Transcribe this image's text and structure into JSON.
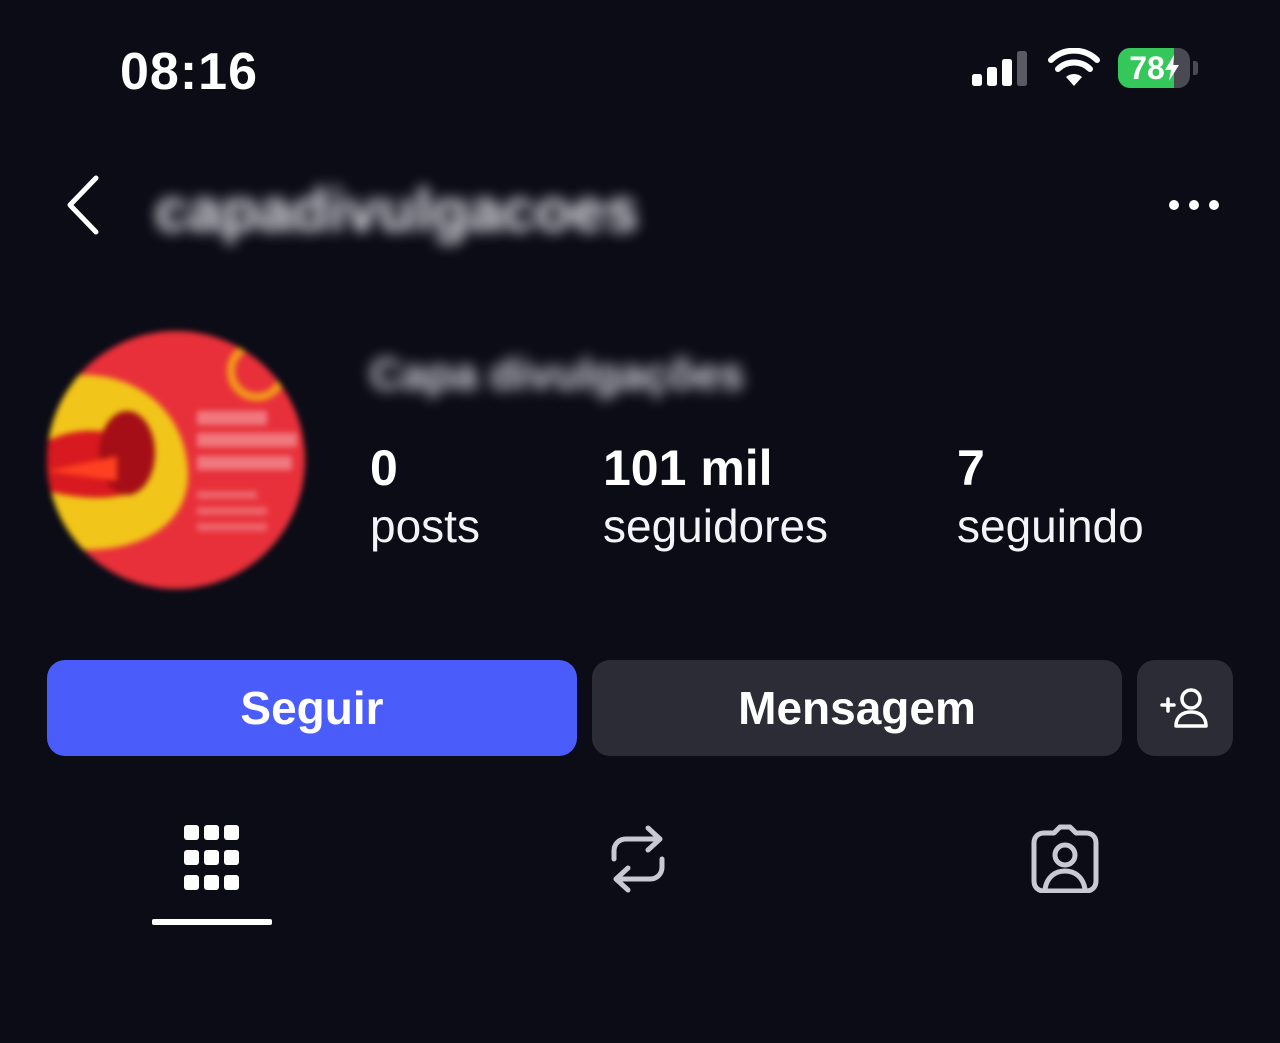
{
  "status_bar": {
    "time": "08:16",
    "battery_level": "78",
    "battery_fill_percent": 78,
    "signal_icon": "cellular-signal-icon",
    "wifi_icon": "wifi-icon",
    "charging_icon": "bolt-icon"
  },
  "header": {
    "back_icon": "chevron-left-icon",
    "username": "capadivulgacoes",
    "more_icon": "more-horizontal-icon"
  },
  "profile": {
    "display_name": "Capa divulgações",
    "stats": [
      {
        "value": "0",
        "label": "posts"
      },
      {
        "value": "101 mil",
        "label": "seguidores"
      },
      {
        "value": "7",
        "label": "seguindo"
      }
    ]
  },
  "actions": {
    "follow_label": "Seguir",
    "message_label": "Mensagem",
    "add_person_icon": "add-person-icon"
  },
  "tabs": {
    "posts_icon": "grid-icon",
    "reposts_icon": "repost-icon",
    "tagged_icon": "tagged-person-icon",
    "active": "posts"
  },
  "colors": {
    "background": "#0c0c17",
    "follow_button": "#4a5dfa",
    "secondary_button": "#2c2c36",
    "battery_green": "#34c759"
  }
}
